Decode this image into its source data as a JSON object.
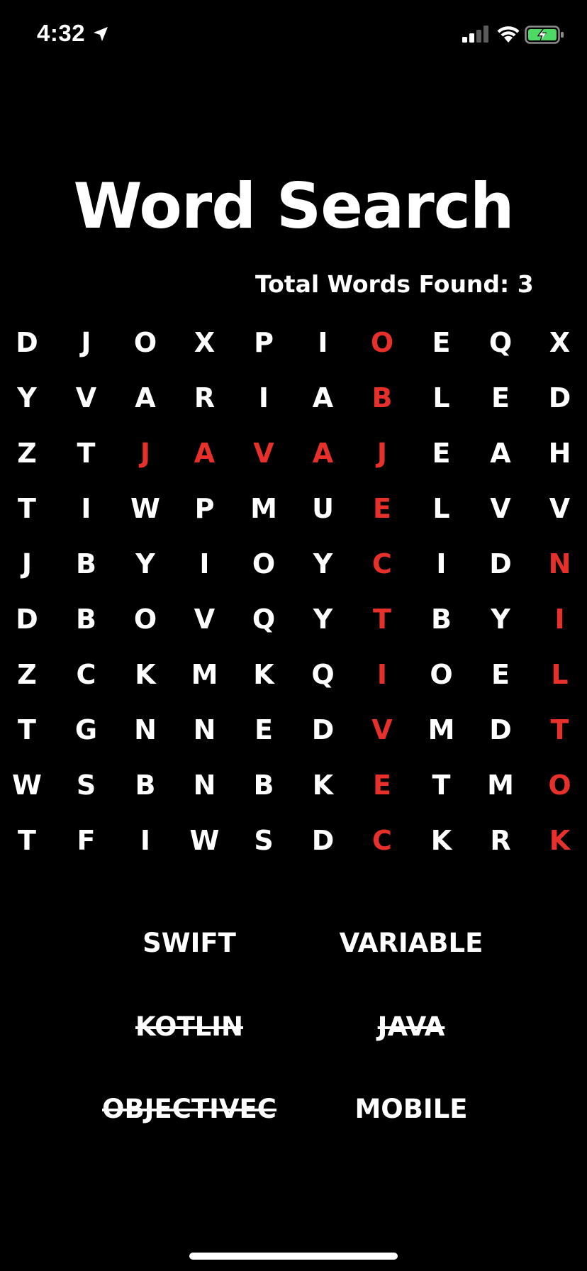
{
  "status_bar": {
    "time": "4:32",
    "location_icon": "location-arrow-icon",
    "signal_icon": "cellular-signal-icon",
    "wifi_icon": "wifi-icon",
    "battery_icon": "battery-charging-icon",
    "battery_color": "#4cd964"
  },
  "title": "Word Search",
  "score_label": "Total Words Found: 3",
  "colors": {
    "background": "#000000",
    "letter": "#ffffff",
    "found_letter": "#e8302a"
  },
  "grid": [
    [
      "D",
      "J",
      "O",
      "X",
      "P",
      "I",
      "O",
      "E",
      "Q",
      "X"
    ],
    [
      "Y",
      "V",
      "A",
      "R",
      "I",
      "A",
      "B",
      "L",
      "E",
      "D"
    ],
    [
      "Z",
      "T",
      "J",
      "A",
      "V",
      "A",
      "J",
      "E",
      "A",
      "H"
    ],
    [
      "T",
      "I",
      "W",
      "P",
      "M",
      "U",
      "E",
      "L",
      "V",
      "V"
    ],
    [
      "J",
      "B",
      "Y",
      "I",
      "O",
      "Y",
      "C",
      "I",
      "D",
      "N"
    ],
    [
      "D",
      "B",
      "O",
      "V",
      "Q",
      "Y",
      "T",
      "B",
      "Y",
      "I"
    ],
    [
      "Z",
      "C",
      "K",
      "M",
      "K",
      "Q",
      "I",
      "O",
      "E",
      "L"
    ],
    [
      "T",
      "G",
      "N",
      "N",
      "E",
      "D",
      "V",
      "M",
      "D",
      "T"
    ],
    [
      "W",
      "S",
      "B",
      "N",
      "B",
      "K",
      "E",
      "T",
      "M",
      "O"
    ],
    [
      "T",
      "F",
      "I",
      "W",
      "S",
      "D",
      "C",
      "K",
      "R",
      "K"
    ]
  ],
  "found_cells": [
    [
      0,
      6
    ],
    [
      1,
      6
    ],
    [
      2,
      6
    ],
    [
      3,
      6
    ],
    [
      4,
      6
    ],
    [
      5,
      6
    ],
    [
      6,
      6
    ],
    [
      7,
      6
    ],
    [
      8,
      6
    ],
    [
      9,
      6
    ],
    [
      2,
      2
    ],
    [
      2,
      3
    ],
    [
      2,
      4
    ],
    [
      2,
      5
    ],
    [
      4,
      9
    ],
    [
      5,
      9
    ],
    [
      6,
      9
    ],
    [
      7,
      9
    ],
    [
      8,
      9
    ],
    [
      9,
      9
    ]
  ],
  "words": [
    {
      "label": "SWIFT",
      "found": false
    },
    {
      "label": "VARIABLE",
      "found": false
    },
    {
      "label": "KOTLIN",
      "found": true
    },
    {
      "label": "JAVA",
      "found": true
    },
    {
      "label": "OBJECTIVEC",
      "found": true
    },
    {
      "label": "MOBILE",
      "found": false
    }
  ]
}
